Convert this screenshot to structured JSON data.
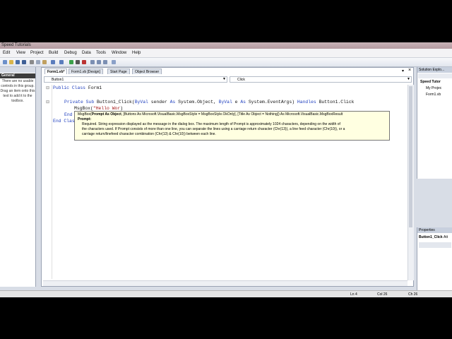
{
  "window": {
    "title": "Speed Tutorials"
  },
  "menu": [
    "Edit",
    "View",
    "Project",
    "Build",
    "Debug",
    "Data",
    "Tools",
    "Window",
    "Help"
  ],
  "toolbox": {
    "group": "General",
    "message": "There are no usable\ncontrols in this group.\nDrag an item onto this\ntext to add it to the\ntoolbox."
  },
  "tabs": [
    "Form1.vb*",
    "Form1.vb [Design]",
    "Start Page",
    "Object Browser"
  ],
  "combos": {
    "left": "Button1",
    "right": "Click"
  },
  "code": {
    "l1_kw": "Public Class",
    "l1_name": " Form1",
    "l2_kw1": "Private Sub",
    "l2_sig": " Button1_Click(",
    "l2_kw2": "ByVal",
    "l2_p1": " sender ",
    "l2_kw3": "As",
    "l2_t1": " System.Object",
    "l2_c": ", ",
    "l2_kw4": "ByVal",
    "l2_p2": " e ",
    "l2_kw5": "As",
    "l2_t2": " System.EventArgs",
    "l2_close": ") ",
    "l2_kw6": "Handles",
    "l2_h": " Button1.Click",
    "l3_fn": "MsgBox(",
    "l3_str": "\"Hello Wor",
    "l4_kw": "End Sub",
    "l5_kw": "End Class"
  },
  "tooltip": {
    "sig_prefix": "MsgBox(",
    "sig_bold": "Prompt As Object",
    "sig_rest": ", [Buttons As Microsoft.VisualBasic.MsgBoxStyle = MsgBoxStyle.OkOnly], [Title As Object = Nothing]) As Microsoft.VisualBasic.MsgBoxResult",
    "param_label": "Prompt:",
    "desc1": "Required. String expression displayed as the message in the dialog box. The maximum length of Prompt is approximately 1024 characters, depending on the width of",
    "desc2": "the characters used. If Prompt consists of more than one line, you can separate the lines using a carriage return character (Chr(13)), a line feed character (Chr(10)), or a",
    "desc3": "carriage return/linefeed character combination (Chr(13) & Chr(10)) between each line."
  },
  "solution": {
    "header": "Solution Explo...",
    "root": "Speed Tutor",
    "items": [
      "My Projec",
      "Form1.vb"
    ]
  },
  "properties": {
    "header": "Properties",
    "object": "Button1_Click",
    "object_tail": "Att"
  },
  "status": {
    "ln": "Ln 4",
    "col": "Col 26",
    "ch": "Ch 26"
  }
}
